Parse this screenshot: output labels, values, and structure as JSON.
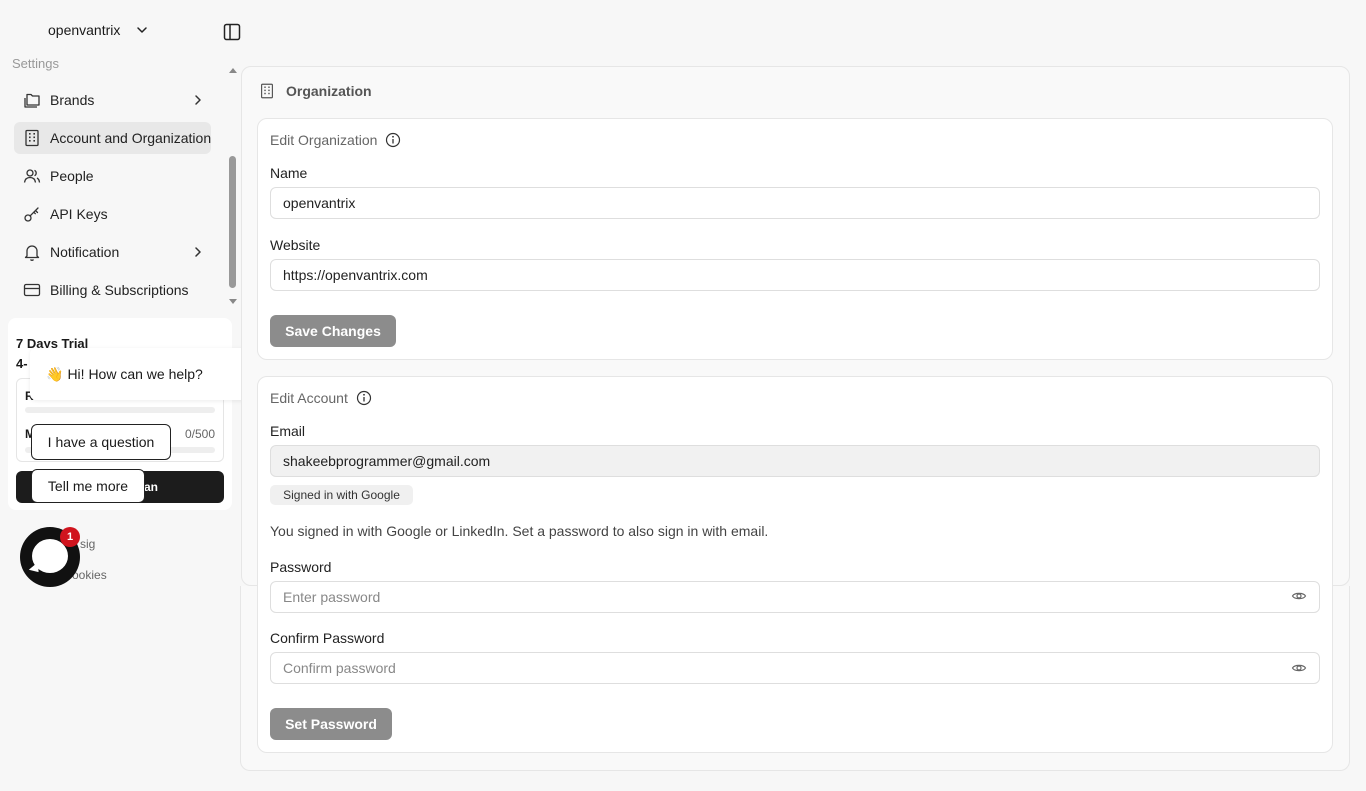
{
  "topbar": {
    "org_name": "openvantrix"
  },
  "sidebar": {
    "section_label": "Settings",
    "items": [
      {
        "label": "Brands",
        "icon": "folders-icon",
        "has_chevron": true
      },
      {
        "label": "Account and Organization",
        "icon": "building-icon",
        "active": true
      },
      {
        "label": "People",
        "icon": "users-icon"
      },
      {
        "label": "API Keys",
        "icon": "key-icon"
      },
      {
        "label": "Notification",
        "icon": "bell-icon",
        "has_chevron": true
      },
      {
        "label": "Billing & Subscriptions",
        "icon": "credit-card-icon"
      }
    ]
  },
  "trial": {
    "title": "7 Days Trial",
    "subtitle": "4-",
    "usage_r_label": "R",
    "usage_m_label": "M",
    "usage_count": "0/500",
    "upgrade_label": "an"
  },
  "chat": {
    "greeting_emoji": "👋",
    "greeting": "Hi! How can we help?",
    "option_1": "I have a question",
    "option_2": "Tell me more",
    "badge_count": "1"
  },
  "footer": {
    "link_1": "sig",
    "link_2": "ookies"
  },
  "main": {
    "heading": "Organization",
    "edit_org": {
      "title": "Edit Organization",
      "name_label": "Name",
      "name_value": "openvantrix",
      "website_label": "Website",
      "website_value": "https://openvantrix.com",
      "save_label": "Save Changes"
    },
    "edit_account": {
      "title": "Edit Account",
      "email_label": "Email",
      "email_value": "shakeebprogrammer@gmail.com",
      "signed_in_chip": "Signed in with Google",
      "info_text": "You signed in with Google or LinkedIn. Set a password to also sign in with email.",
      "password_label": "Password",
      "password_placeholder": "Enter password",
      "confirm_label": "Confirm Password",
      "confirm_placeholder": "Confirm password",
      "set_password_label": "Set Password"
    }
  },
  "colors": {
    "active_bg": "#e8e8e8",
    "button_gray": "#8c8c8c",
    "badge_red": "#d0141e"
  }
}
